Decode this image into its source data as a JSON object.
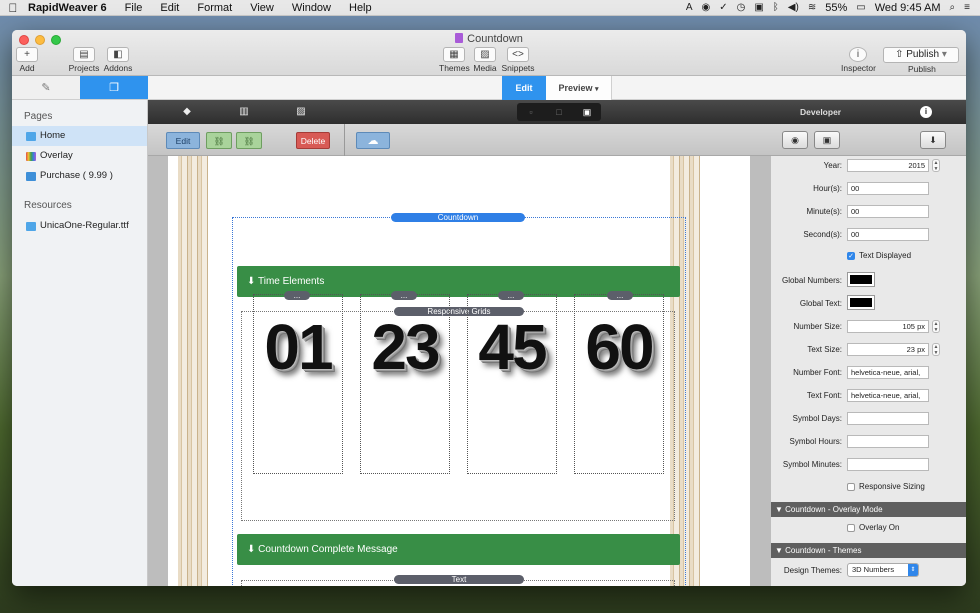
{
  "menubar": {
    "apple": "",
    "app_name": "RapidWeaver 6",
    "items": [
      "File",
      "Edit",
      "Format",
      "View",
      "Window",
      "Help"
    ],
    "status": {
      "battery": "55%",
      "clock": "Wed 9:45 AM"
    }
  },
  "window": {
    "title": "Countdown",
    "toolbar": {
      "add": "Add",
      "projects": "Projects",
      "addons": "Addons",
      "themes": "Themes",
      "media": "Media",
      "snippets": "Snippets",
      "inspector": "Inspector",
      "publish_button": "Publish",
      "publish_caption": "Publish"
    }
  },
  "sidebar": {
    "pages_header": "Pages",
    "pages": [
      {
        "label": "Home",
        "color": "#4fa6e8"
      },
      {
        "label": "Overlay",
        "color": "#c455c9"
      },
      {
        "label": "Purchase ( 9.99 )",
        "color": "#3e8fd8"
      }
    ],
    "resources_header": "Resources",
    "resources": [
      {
        "label": "UnicaOne-Regular.ttf",
        "color": "#4fa6e8"
      }
    ]
  },
  "view_tabs": {
    "edit": "Edit",
    "preview": "Preview"
  },
  "editor_toolbar": {
    "edit": "Edit",
    "delete": "Delete"
  },
  "canvas": {
    "countdown_pill": "Countdown",
    "time_elements": "Time Elements",
    "responsive_grids": "Responsive Grids",
    "cell_pill": "...",
    "numbers": [
      "01",
      "23",
      "45",
      "60"
    ],
    "complete_message": "Countdown Complete Message",
    "text_pill": "Text"
  },
  "developer": {
    "header": "Developer",
    "fields": {
      "year_label": "Year:",
      "year": "2015",
      "hours_label": "Hour(s):",
      "hours": "00",
      "minutes_label": "Minute(s):",
      "minutes": "00",
      "seconds_label": "Second(s):",
      "seconds": "00",
      "text_displayed": "Text Displayed",
      "global_numbers_label": "Global Numbers:",
      "global_text_label": "Global Text:",
      "number_size_label": "Number Size:",
      "number_size": "105 px",
      "text_size_label": "Text Size:",
      "text_size": "23 px",
      "number_font_label": "Number Font:",
      "number_font": "helvetica-neue, arial,",
      "text_font_label": "Text Font:",
      "text_font": "helvetica-neue, arial,",
      "symbol_days_label": "Symbol Days:",
      "symbol_hours_label": "Symbol Hours:",
      "symbol_minutes_label": "Symbol Minutes:",
      "responsive_sizing": "Responsive Sizing"
    },
    "overlay_section": "Countdown - Overlay Mode",
    "overlay_on": "Overlay On",
    "themes_section": "Countdown - Themes",
    "design_themes_label": "Design Themes:",
    "design_themes_value": "3D Numbers"
  }
}
